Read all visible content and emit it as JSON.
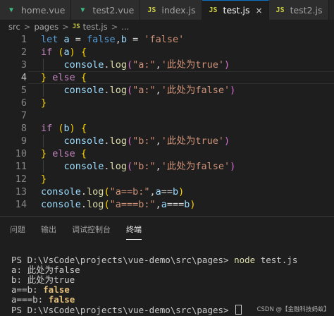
{
  "tabs": [
    {
      "icon": "vue-icon",
      "label": "home.vue",
      "active": false
    },
    {
      "icon": "vue-icon",
      "label": "test2.vue",
      "active": false
    },
    {
      "icon": "js-icon",
      "label": "index.js",
      "active": false
    },
    {
      "icon": "js-icon",
      "label": "test.js",
      "active": true,
      "close": "×"
    },
    {
      "icon": "js-icon",
      "label": "test2.js",
      "active": false
    }
  ],
  "breadcrumb": {
    "parts": [
      "src",
      "pages",
      "test.js",
      "..."
    ],
    "separator": ">",
    "js_badge": "JS"
  },
  "editor": {
    "line_numbers": [
      "1",
      "2",
      "3",
      "4",
      "5",
      "6",
      "7",
      "8",
      "9",
      "10",
      "11",
      "12",
      "13",
      "14"
    ],
    "current_line": 4,
    "lines": [
      [
        {
          "t": "kw",
          "s": "let "
        },
        {
          "t": "var",
          "s": "a"
        },
        {
          "t": "op",
          "s": " = "
        },
        {
          "t": "kw",
          "s": "false"
        },
        {
          "t": "op",
          "s": ","
        },
        {
          "t": "var",
          "s": "b"
        },
        {
          "t": "op",
          "s": " = "
        },
        {
          "t": "str",
          "s": "'false'"
        }
      ],
      [
        {
          "t": "kw2",
          "s": "if "
        },
        {
          "t": "br1",
          "s": "("
        },
        {
          "t": "var",
          "s": "a"
        },
        {
          "t": "br1",
          "s": ")"
        },
        {
          "t": "op",
          "s": " "
        },
        {
          "t": "br1",
          "s": "{"
        }
      ],
      [
        {
          "t": "op",
          "s": "    "
        },
        {
          "t": "var",
          "s": "console"
        },
        {
          "t": "op",
          "s": "."
        },
        {
          "t": "fn",
          "s": "log"
        },
        {
          "t": "br2",
          "s": "("
        },
        {
          "t": "str",
          "s": "\"a:\""
        },
        {
          "t": "op",
          "s": ","
        },
        {
          "t": "str",
          "s": "'此处为true'"
        },
        {
          "t": "br2",
          "s": ")"
        }
      ],
      [
        {
          "t": "br1",
          "s": "}"
        },
        {
          "t": "kw2",
          "s": " else "
        },
        {
          "t": "br1",
          "s": "{"
        }
      ],
      [
        {
          "t": "op",
          "s": "    "
        },
        {
          "t": "var",
          "s": "console"
        },
        {
          "t": "op",
          "s": "."
        },
        {
          "t": "fn",
          "s": "log"
        },
        {
          "t": "br2",
          "s": "("
        },
        {
          "t": "str",
          "s": "\"a:\""
        },
        {
          "t": "op",
          "s": ","
        },
        {
          "t": "str",
          "s": "'此处为false'"
        },
        {
          "t": "br2",
          "s": ")"
        }
      ],
      [
        {
          "t": "br1",
          "s": "}"
        }
      ],
      [],
      [
        {
          "t": "kw2",
          "s": "if "
        },
        {
          "t": "br1",
          "s": "("
        },
        {
          "t": "var",
          "s": "b"
        },
        {
          "t": "br1",
          "s": ")"
        },
        {
          "t": "op",
          "s": " "
        },
        {
          "t": "br1",
          "s": "{"
        }
      ],
      [
        {
          "t": "op",
          "s": "    "
        },
        {
          "t": "var",
          "s": "console"
        },
        {
          "t": "op",
          "s": "."
        },
        {
          "t": "fn",
          "s": "log"
        },
        {
          "t": "br2",
          "s": "("
        },
        {
          "t": "str",
          "s": "\"b:\""
        },
        {
          "t": "op",
          "s": ","
        },
        {
          "t": "str",
          "s": "'此处为true'"
        },
        {
          "t": "br2",
          "s": ")"
        }
      ],
      [
        {
          "t": "br1",
          "s": "}"
        },
        {
          "t": "kw2",
          "s": " else "
        },
        {
          "t": "br1",
          "s": "{"
        }
      ],
      [
        {
          "t": "op",
          "s": "    "
        },
        {
          "t": "var",
          "s": "console"
        },
        {
          "t": "op",
          "s": "."
        },
        {
          "t": "fn",
          "s": "log"
        },
        {
          "t": "br2",
          "s": "("
        },
        {
          "t": "str",
          "s": "\"b:\""
        },
        {
          "t": "op",
          "s": ","
        },
        {
          "t": "str",
          "s": "'此处为false'"
        },
        {
          "t": "br2",
          "s": ")"
        }
      ],
      [
        {
          "t": "br1",
          "s": "}"
        }
      ],
      [
        {
          "t": "var",
          "s": "console"
        },
        {
          "t": "op",
          "s": "."
        },
        {
          "t": "fn",
          "s": "log"
        },
        {
          "t": "br1",
          "s": "("
        },
        {
          "t": "str",
          "s": "\"a==b:\""
        },
        {
          "t": "op",
          "s": ","
        },
        {
          "t": "var",
          "s": "a"
        },
        {
          "t": "op",
          "s": "=="
        },
        {
          "t": "var",
          "s": "b"
        },
        {
          "t": "br1",
          "s": ")"
        }
      ],
      [
        {
          "t": "var",
          "s": "console"
        },
        {
          "t": "op",
          "s": "."
        },
        {
          "t": "fn",
          "s": "log"
        },
        {
          "t": "br1",
          "s": "("
        },
        {
          "t": "str",
          "s": "\"a===b:\""
        },
        {
          "t": "op",
          "s": ","
        },
        {
          "t": "var",
          "s": "a"
        },
        {
          "t": "op",
          "s": "==="
        },
        {
          "t": "var",
          "s": "b"
        },
        {
          "t": "br1",
          "s": ")"
        }
      ]
    ]
  },
  "panel": {
    "tabs": [
      {
        "label": "问题",
        "active": false
      },
      {
        "label": "输出",
        "active": false
      },
      {
        "label": "调试控制台",
        "active": false
      },
      {
        "label": "终端",
        "active": true
      }
    ]
  },
  "terminal": {
    "lines": [
      [
        {
          "t": "plain",
          "s": ""
        }
      ],
      [
        {
          "t": "plain",
          "s": "PS D:\\VsCode\\projects\\vue-demo\\src\\pages> "
        },
        {
          "t": "cmd",
          "s": "node"
        },
        {
          "t": "plain",
          "s": " test.js"
        }
      ],
      [
        {
          "t": "plain",
          "s": "a: 此处为false"
        }
      ],
      [
        {
          "t": "plain",
          "s": "b: 此处为true"
        }
      ],
      [
        {
          "t": "plain",
          "s": "a==b: "
        },
        {
          "t": "false",
          "s": "false"
        }
      ],
      [
        {
          "t": "plain",
          "s": "a===b: "
        },
        {
          "t": "false",
          "s": "false"
        }
      ],
      [
        {
          "t": "plain",
          "s": "PS D:\\VsCode\\projects\\vue-demo\\src\\pages> "
        }
      ]
    ]
  },
  "watermark": "CSDN @【金融科技蚂蚁】",
  "colors": {
    "background": "#1e1e1e",
    "tab_active_border": "#0e70c0",
    "keyword": "#569cd6",
    "control": "#c586c0",
    "string": "#ce9178",
    "function": "#dcdcaa",
    "variable": "#9cdcfe"
  }
}
